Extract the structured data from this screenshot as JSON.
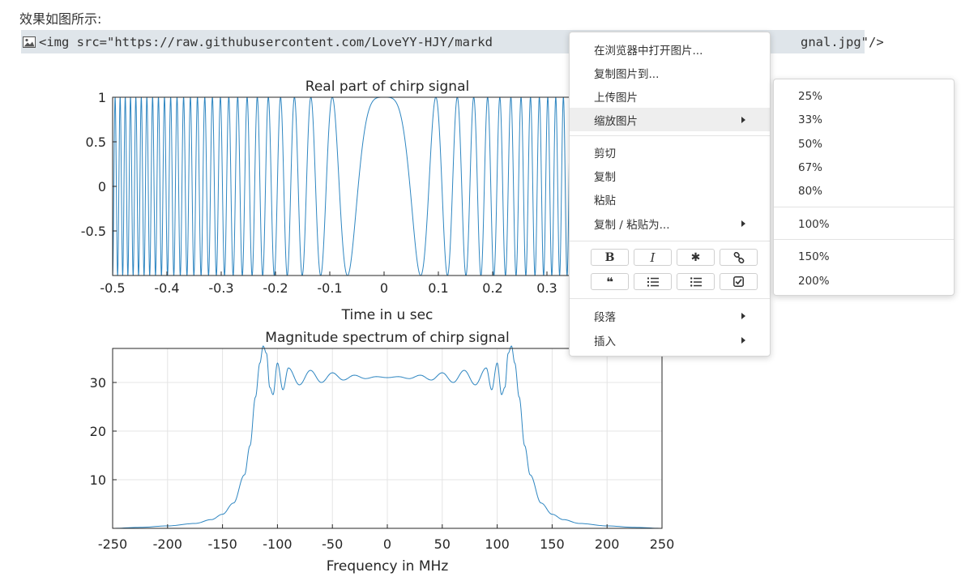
{
  "page": {
    "intro_text": "效果如图所示:",
    "code_line": "<img src=\"https://raw.githubusercontent.com/LoveYY-HJY/markd",
    "code_line_tail": "gnal.jpg\"/>"
  },
  "chart_data": [
    {
      "type": "line",
      "title": "Real part of chirp signal",
      "xlabel": "Time in u sec",
      "ylabel": "",
      "xlim": [
        -0.5,
        0.5
      ],
      "ylim": [
        -1,
        1
      ],
      "xticks": [
        "-0.5",
        "-0.4",
        "-0.3",
        "-0.2",
        "-0.1",
        "0",
        "0.1",
        "0.2",
        "0.3"
      ],
      "yticks": [
        "1",
        "0.5",
        "0",
        "-0.5"
      ],
      "grid": false,
      "series": [
        {
          "color": "#2e86c1",
          "function": "cos(pi*k*t^2)",
          "k": 220,
          "t_range": [
            -0.5,
            0.5
          ]
        }
      ]
    },
    {
      "type": "line",
      "title": "Magnitude spectrum of chirp signal",
      "xlabel": "Frequency in MHz",
      "ylabel": "",
      "xlim": [
        -250,
        250
      ],
      "ylim": [
        0,
        37
      ],
      "xticks": [
        "-250",
        "-200",
        "-150",
        "-100",
        "-50",
        "0",
        "50",
        "100",
        "150",
        "200",
        "250"
      ],
      "yticks": [
        "30",
        "20",
        "10"
      ],
      "grid": true,
      "series": [
        {
          "color": "#2e86c1",
          "x": [
            -250,
            -225,
            -200,
            -175,
            -160,
            -150,
            -140,
            -130,
            -125,
            -120,
            -116,
            -113,
            -110,
            -107,
            -104,
            -100,
            -95,
            -90,
            -80,
            -70,
            -60,
            -50,
            -40,
            -30,
            -20,
            -10,
            0,
            10,
            20,
            30,
            40,
            50,
            60,
            70,
            80,
            90,
            95,
            100,
            104,
            107,
            110,
            113,
            116,
            120,
            125,
            130,
            140,
            150,
            160,
            175,
            200,
            225,
            250
          ],
          "y": [
            0.0,
            0.2,
            0.5,
            1.0,
            1.8,
            2.9,
            5.2,
            11.0,
            17.0,
            27.0,
            34.0,
            37.5,
            36.0,
            29.0,
            27.5,
            34.0,
            28.5,
            33.0,
            29.5,
            32.5,
            30.0,
            32.0,
            30.5,
            31.5,
            30.8,
            31.2,
            31.0,
            31.2,
            30.8,
            31.5,
            30.5,
            32.0,
            30.0,
            32.5,
            29.5,
            33.0,
            28.5,
            34.0,
            27.5,
            29.0,
            36.0,
            37.5,
            34.0,
            27.0,
            17.0,
            11.0,
            5.2,
            2.9,
            1.8,
            1.0,
            0.5,
            0.2,
            0.0
          ]
        }
      ]
    }
  ],
  "context_menu": {
    "items": [
      {
        "label": "在浏览器中打开图片...",
        "submenu": false
      },
      {
        "label": "复制图片到...",
        "submenu": false
      },
      {
        "label": "上传图片",
        "submenu": false
      },
      {
        "label": "缩放图片",
        "submenu": true,
        "active": true
      },
      {
        "label": "剪切",
        "submenu": false
      },
      {
        "label": "复制",
        "submenu": false
      },
      {
        "label": "粘贴",
        "submenu": false
      },
      {
        "label": "复制 / 粘贴为...",
        "submenu": true
      },
      {
        "label": "段落",
        "submenu": true
      },
      {
        "label": "插入",
        "submenu": true
      }
    ],
    "format_buttons": [
      {
        "glyph": "B",
        "icon": "bold-icon"
      },
      {
        "glyph": "I",
        "icon": "italic-icon"
      },
      {
        "glyph": "✱",
        "icon": "asterisk-icon"
      },
      {
        "glyph": "",
        "icon": "link-icon"
      },
      {
        "glyph": "❝",
        "icon": "quote-icon"
      },
      {
        "glyph": "",
        "icon": "ordered-list-icon"
      },
      {
        "glyph": "",
        "icon": "unordered-list-icon"
      },
      {
        "glyph": "",
        "icon": "task-list-icon"
      }
    ]
  },
  "zoom_submenu": {
    "items": [
      "25%",
      "33%",
      "50%",
      "67%",
      "80%",
      "100%",
      "150%",
      "200%"
    ]
  }
}
